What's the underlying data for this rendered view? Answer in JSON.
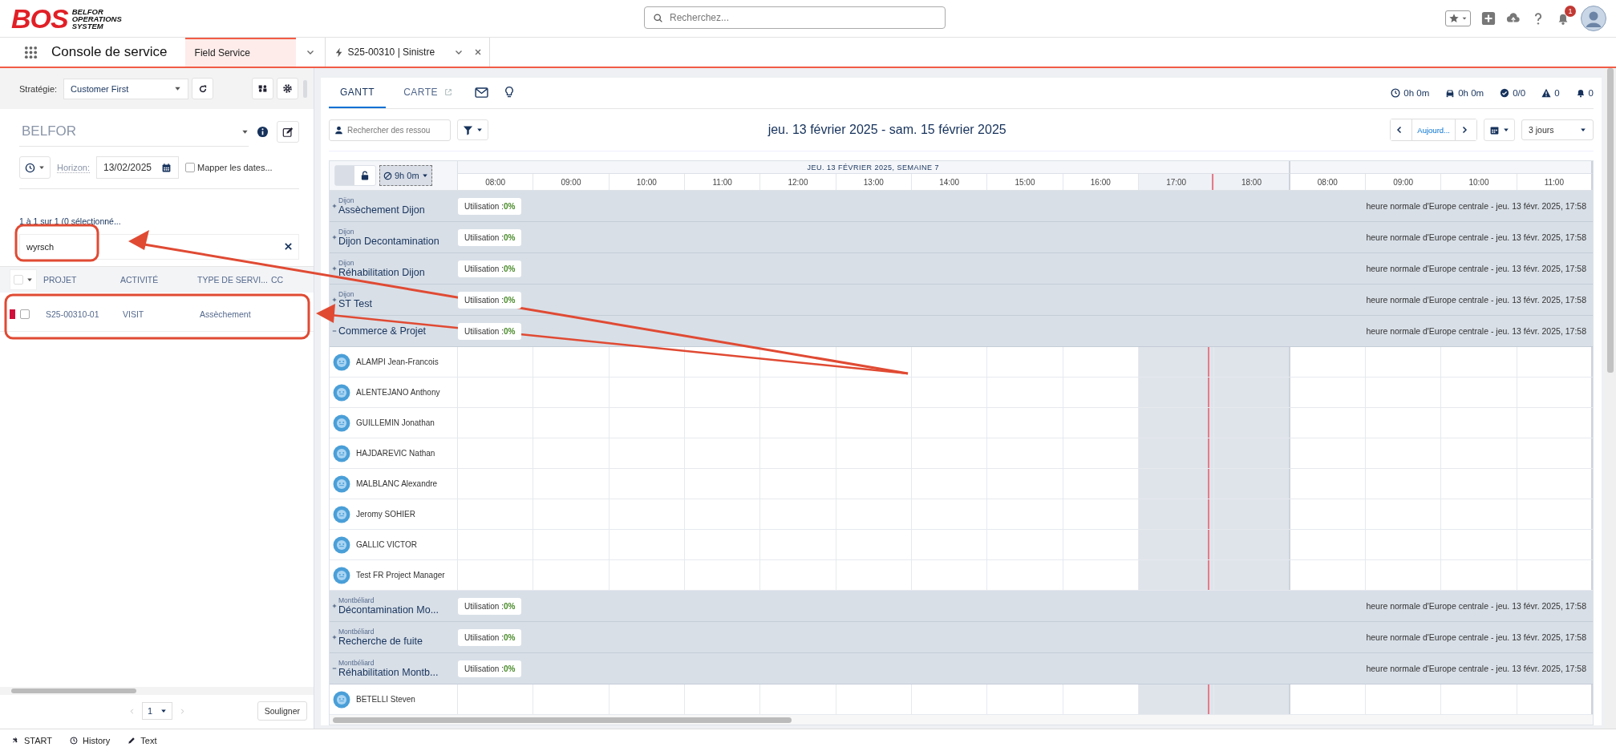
{
  "header": {
    "logo": {
      "mark": "BOS",
      "lines": [
        "BELFOR",
        "OPERATIONS",
        "SYSTEM"
      ]
    },
    "search": {
      "placeholder": "Recherchez..."
    },
    "notifications": "1"
  },
  "nav": {
    "app": "Console de service",
    "tabs": [
      {
        "label": "Field Service",
        "selected": true,
        "kind": "module"
      },
      {
        "label": "S25-00310 | Sinistre",
        "selected": false,
        "kind": "record"
      }
    ]
  },
  "left": {
    "strategy_label": "Stratégie:",
    "strategy": "Customer First",
    "territory": "BELFOR",
    "horizon_label": "Horizon:",
    "horizon": "13/02/2025",
    "map_dates": {
      "label": "Mapper les dates...",
      "checked": false
    },
    "count": "1 à 1 sur 1 (0 sélectionné...",
    "search": {
      "value": "wyrsch"
    },
    "columns": [
      "PROJET",
      "ACTIVITÉ",
      "TYPE DE SERVI...",
      "CC"
    ],
    "rows": [
      {
        "color": "#d0103a",
        "checked": false,
        "cells": [
          "S25-00310-01",
          "VISIT",
          "Assèchement"
        ]
      }
    ],
    "page": "1",
    "highlight_button": "Souligner"
  },
  "right": {
    "tabs": [
      {
        "label": "GANTT",
        "selected": true,
        "kind": "text"
      },
      {
        "label": "CARTE",
        "selected": false,
        "kind": "external"
      },
      {
        "kind": "mail",
        "selected": false
      },
      {
        "kind": "bulb",
        "selected": false
      }
    ],
    "stats": [
      {
        "kind": "clock",
        "value": "0h 0m"
      },
      {
        "kind": "car",
        "value": "0h 0m"
      },
      {
        "kind": "check",
        "value": "0/0"
      },
      {
        "kind": "warning",
        "value": "0"
      },
      {
        "kind": "bell",
        "value": "0"
      }
    ],
    "resource_search": {
      "placeholder": "Rechercher des ressou"
    },
    "date_range": "jeu. 13 février 2025 - sam. 15 février 2025",
    "today": "Aujourd...",
    "view": "3 jours",
    "gantt": {
      "duration": "9h 0m",
      "locked": false,
      "days": [
        {
          "label": "JEU. 13 FÉVRIER 2025, SEMAINE 7",
          "hours": [
            {
              "label": "08:00",
              "off_hours": false,
              "now": false
            },
            {
              "label": "09:00",
              "off_hours": false,
              "now": false
            },
            {
              "label": "10:00",
              "off_hours": false,
              "now": false
            },
            {
              "label": "11:00",
              "off_hours": false,
              "now": false
            },
            {
              "label": "12:00",
              "off_hours": false,
              "now": false
            },
            {
              "label": "13:00",
              "off_hours": false,
              "now": false
            },
            {
              "label": "14:00",
              "off_hours": false,
              "now": false
            },
            {
              "label": "15:00",
              "off_hours": false,
              "now": false
            },
            {
              "label": "16:00",
              "off_hours": false,
              "now": false
            },
            {
              "label": "17:00",
              "off_hours": true,
              "now": true
            },
            {
              "label": "18:00",
              "off_hours": true,
              "now": false
            }
          ]
        },
        {
          "hours": [
            {
              "label": "08:00",
              "off_hours": false,
              "now": false
            },
            {
              "label": "09:00",
              "off_hours": false,
              "now": false
            },
            {
              "label": "10:00",
              "off_hours": false,
              "now": false
            },
            {
              "label": "11:00",
              "off_hours": false,
              "now": false
            }
          ]
        }
      ],
      "territories": [
        {
          "region": "Dijon",
          "name": "Assèchement Dijon",
          "expanded": false,
          "utilisation_label": "Utilisation :",
          "utilisation": "0%",
          "timezone": "heure normale d'Europe centrale - jeu. 13 févr. 2025, 17:58"
        },
        {
          "region": "Dijon",
          "name": "Dijon Decontamination",
          "expanded": false,
          "utilisation_label": "Utilisation :",
          "utilisation": "0%",
          "timezone": "heure normale d'Europe centrale - jeu. 13 févr. 2025, 17:58"
        },
        {
          "region": "Dijon",
          "name": "Réhabilitation Dijon",
          "expanded": false,
          "utilisation_label": "Utilisation :",
          "utilisation": "0%",
          "timezone": "heure normale d'Europe centrale - jeu. 13 févr. 2025, 17:58"
        },
        {
          "region": "Dijon",
          "name": "ST Test",
          "expanded": false,
          "utilisation_label": "Utilisation :",
          "utilisation": "0%",
          "timezone": "heure normale d'Europe centrale - jeu. 13 févr. 2025, 17:58"
        },
        {
          "name": "Commerce & Projet",
          "expanded": true,
          "utilisation_label": "Utilisation :",
          "utilisation": "0%",
          "timezone": "heure normale d'Europe centrale - jeu. 13 févr. 2025, 17:58",
          "children": [
            {
              "name": "ALAMPI Jean-Francois"
            },
            {
              "name": "ALENTEJANO Anthony"
            },
            {
              "name": "GUILLEMIN Jonathan"
            },
            {
              "name": "HAJDAREVIC Nathan"
            },
            {
              "name": "MALBLANC Alexandre"
            },
            {
              "name": "Jeromy SOHIER"
            },
            {
              "name": "GALLIC VICTOR"
            },
            {
              "name": "Test FR Project Manager"
            }
          ]
        },
        {
          "region": "Montbéliard",
          "name": "Décontamination Mo...",
          "expanded": false,
          "utilisation_label": "Utilisation :",
          "utilisation": "0%",
          "timezone": "heure normale d'Europe centrale - jeu. 13 févr. 2025, 17:58"
        },
        {
          "region": "Montbéliard",
          "name": "Recherche de fuite",
          "expanded": false,
          "utilisation_label": "Utilisation :",
          "utilisation": "0%",
          "timezone": "heure normale d'Europe centrale - jeu. 13 févr. 2025, 17:58"
        },
        {
          "region": "Montbéliard",
          "name": "Réhabilitation Montb...",
          "expanded": true,
          "utilisation_label": "Utilisation :",
          "utilisation": "0%",
          "timezone": "heure normale d'Europe centrale - jeu. 13 févr. 2025, 17:58",
          "children": [
            {
              "name": "BETELLI Steven"
            }
          ]
        }
      ]
    }
  },
  "footer": [
    {
      "kind": "pin",
      "label": "START"
    },
    {
      "kind": "history",
      "label": "History"
    },
    {
      "kind": "pen",
      "label": "Text"
    }
  ]
}
